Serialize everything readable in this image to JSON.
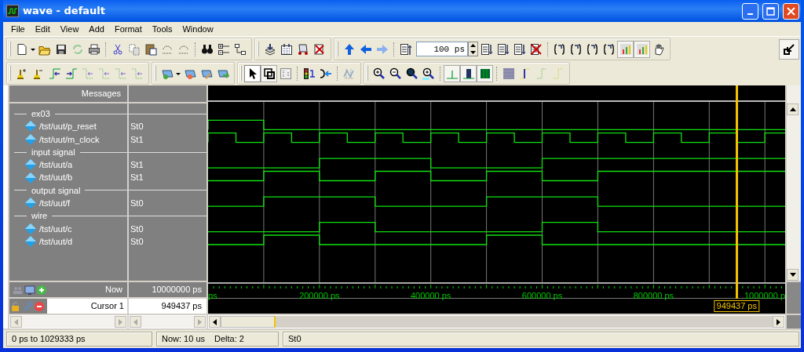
{
  "window": {
    "title": "wave - default"
  },
  "menu": [
    {
      "label": "File"
    },
    {
      "label": "Edit"
    },
    {
      "label": "View"
    },
    {
      "label": "Add"
    },
    {
      "label": "Format"
    },
    {
      "label": "Tools"
    },
    {
      "label": "Window"
    }
  ],
  "toolbar": {
    "time_step": "100 ps"
  },
  "signal_pane": {
    "header": "Messages",
    "rows": [
      {
        "kind": "group",
        "label": "ex03"
      },
      {
        "kind": "signal",
        "name": "/tst/uut/p_reset",
        "value": "St0"
      },
      {
        "kind": "signal",
        "name": "/tst/uut/m_clock",
        "value": "St1"
      },
      {
        "kind": "group",
        "label": "input signal"
      },
      {
        "kind": "signal",
        "name": "/tst/uut/a",
        "value": "St1"
      },
      {
        "kind": "signal",
        "name": "/tst/uut/b",
        "value": "St1"
      },
      {
        "kind": "group",
        "label": "output signal"
      },
      {
        "kind": "signal",
        "name": "/tst/uut/f",
        "value": "St0"
      },
      {
        "kind": "group",
        "label": "wire"
      },
      {
        "kind": "signal",
        "name": "/tst/uut/c",
        "value": "St0"
      },
      {
        "kind": "signal",
        "name": "/tst/uut/d",
        "value": "St0"
      }
    ]
  },
  "timeline": {
    "labels": [
      "ps",
      "200000 ps",
      "400000 ps",
      "600000 ps",
      "800000 ps",
      "1000000 p"
    ]
  },
  "now": {
    "label": "Now",
    "value": "10000000 ps"
  },
  "cursor": {
    "label": "Cursor 1",
    "value": "949437 ps",
    "tag": "949437 ps",
    "level": 0.916
  },
  "status_bar": {
    "range": "0 ps to 1029333 ps",
    "now": "Now: 10 us",
    "delta": "Delta: 2",
    "value": "St0"
  }
}
